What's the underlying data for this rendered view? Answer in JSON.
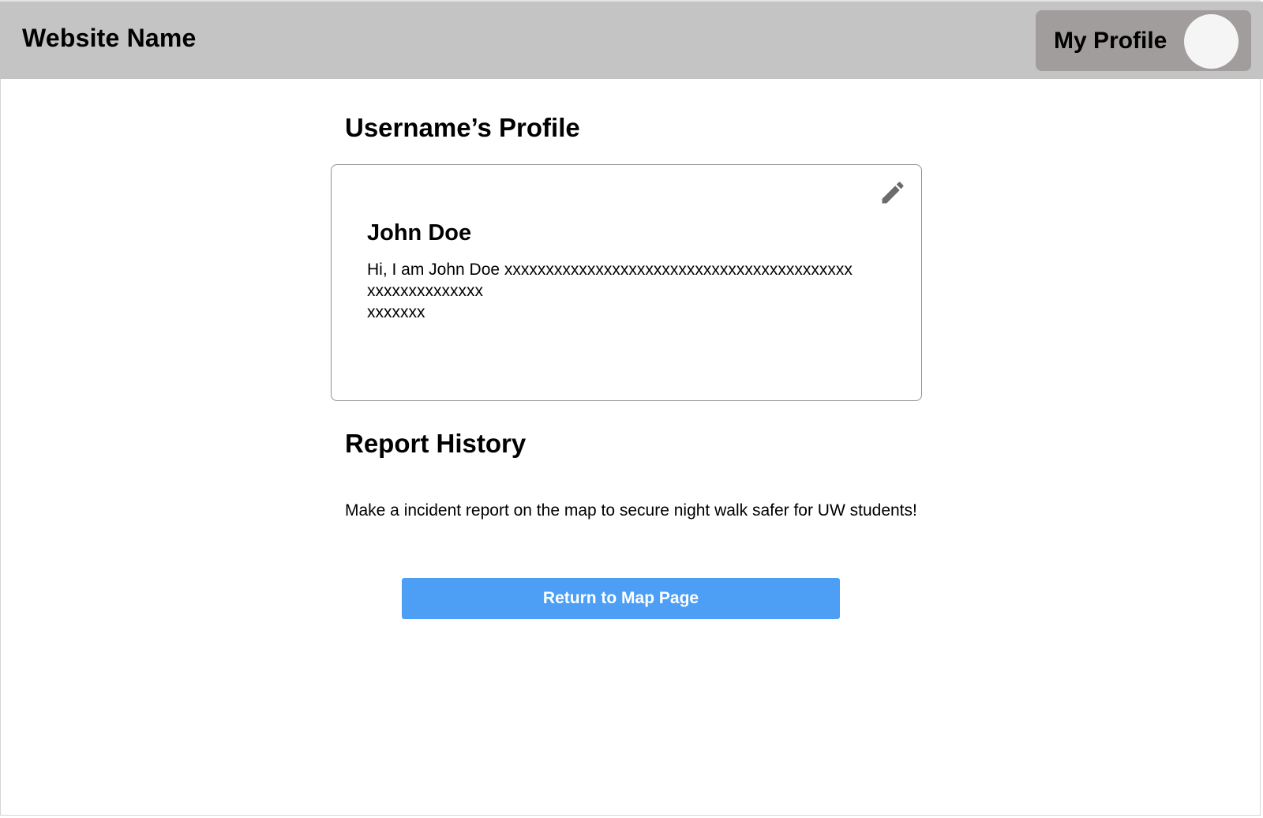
{
  "header": {
    "site_name": "Website Name",
    "profile_label": "My Profile"
  },
  "profile": {
    "title": "Username’s Profile",
    "name": "John Doe",
    "bio": "Hi, I am John Doe xxxxxxxxxxxxxxxxxxxxxxxxxxxxxxxxxxxxxxxxxx\nxxxxxxxxxxxxxx\nxxxxxxx",
    "edit_icon": "pencil-icon"
  },
  "report_history": {
    "title": "Report History",
    "empty_message": "Make a incident report on the map to secure night walk safer for UW students!"
  },
  "actions": {
    "return_label": "Return to Map Page"
  },
  "colors": {
    "header_bg": "#c4c4c4",
    "profile_button_bg": "#a19d9c",
    "avatar_bg": "#f5f5f5",
    "primary_button_bg": "#4d9ff5",
    "card_border": "#8f8f8f",
    "icon_color": "#6b6b6b"
  }
}
